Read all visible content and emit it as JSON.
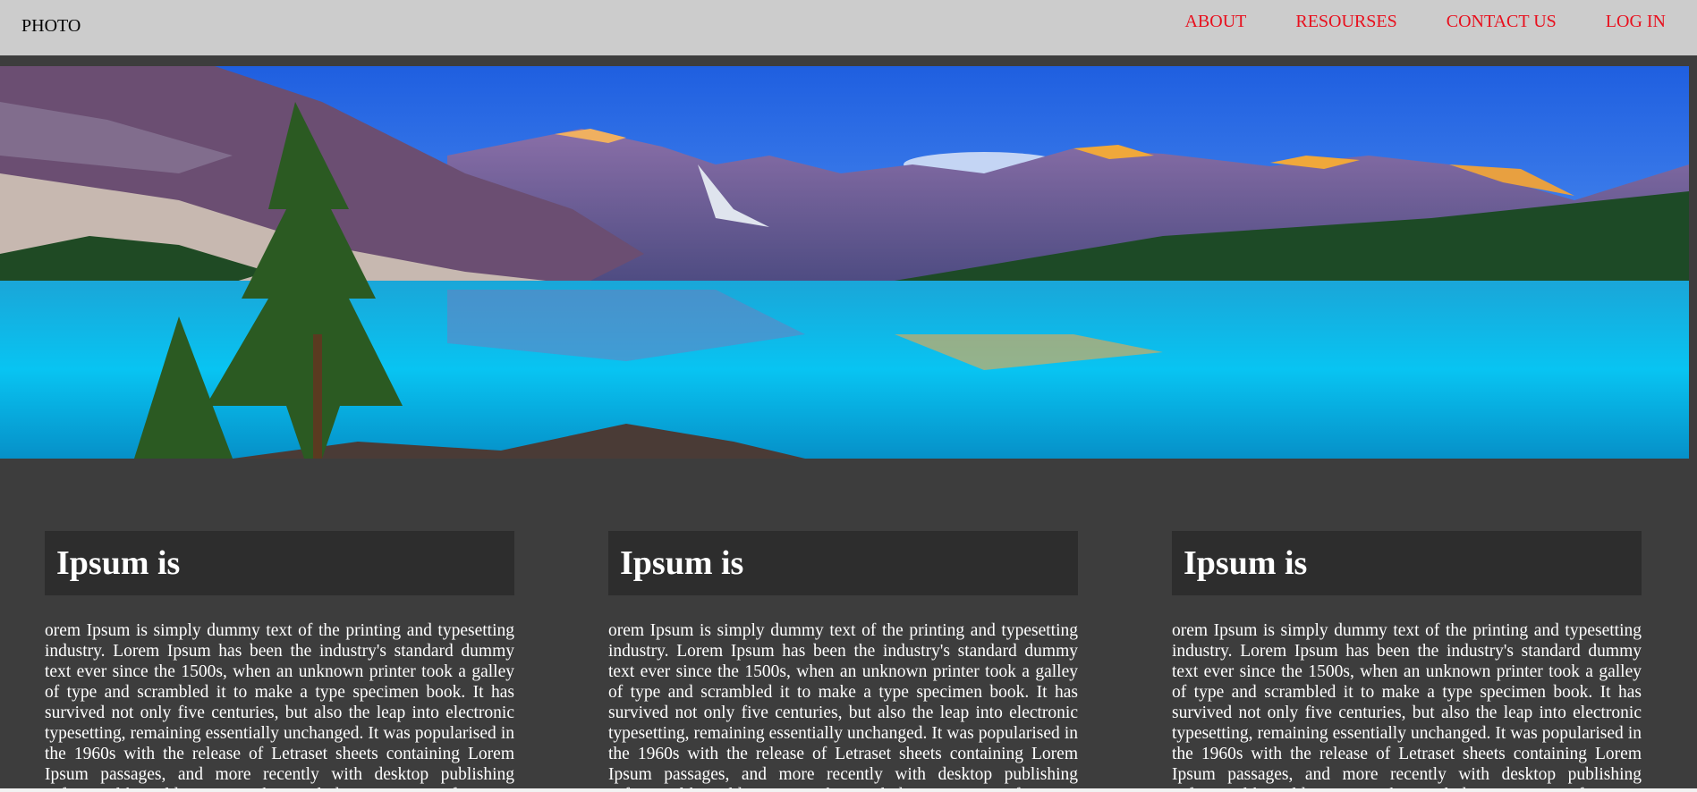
{
  "nav": {
    "brand": "PHOTO",
    "links": [
      "ABOUT",
      "RESOURSES",
      "CONTACT US",
      "LOG IN"
    ],
    "link_color": "#e8101e",
    "background": "#cccccc"
  },
  "hero": {
    "image_icon": "mountain-lake-landscape"
  },
  "cards": [
    {
      "title": "Ipsum is",
      "body": "orem Ipsum is simply dummy text of the printing and typesetting industry. Lorem Ipsum has been the industry's standard dummy text ever since the 1500s, when an unknown printer took a galley of type and scrambled it to make a type specimen book. It has survived not only five centuries, but also the leap into electronic typesetting, remaining essentially unchanged. It was popularised in the 1960s with the release of Letraset sheets containing Lorem Ipsum passages, and more recently with desktop publishing software like Aldus PageMaker including versions of Lorem Ipsum."
    },
    {
      "title": "Ipsum is",
      "body": "orem Ipsum is simply dummy text of the printing and typesetting industry. Lorem Ipsum has been the industry's standard dummy text ever since the 1500s, when an unknown printer took a galley of type and scrambled it to make a type specimen book. It has survived not only five centuries, but also the leap into electronic typesetting, remaining essentially unchanged. It was popularised in the 1960s with the release of Letraset sheets containing Lorem Ipsum passages, and more recently with desktop publishing software like Aldus PageMaker including versions of Lorem Ipsum."
    },
    {
      "title": "Ipsum is",
      "body": "orem Ipsum is simply dummy text of the printing and typesetting industry. Lorem Ipsum has been the industry's standard dummy text ever since the 1500s, when an unknown printer took a galley of type and scrambled it to make a type specimen book. It has survived not only five centuries, but also the leap into electronic typesetting, remaining essentially unchanged. It was popularised in the 1960s with the release of Letraset sheets containing Lorem Ipsum passages, and more recently with desktop publishing software like Aldus PageMaker including versions of Lorem Ipsum."
    }
  ],
  "colors": {
    "page_background": "#3d3d3d",
    "card_header": "#2d2d2d",
    "text": "#ffffff"
  }
}
